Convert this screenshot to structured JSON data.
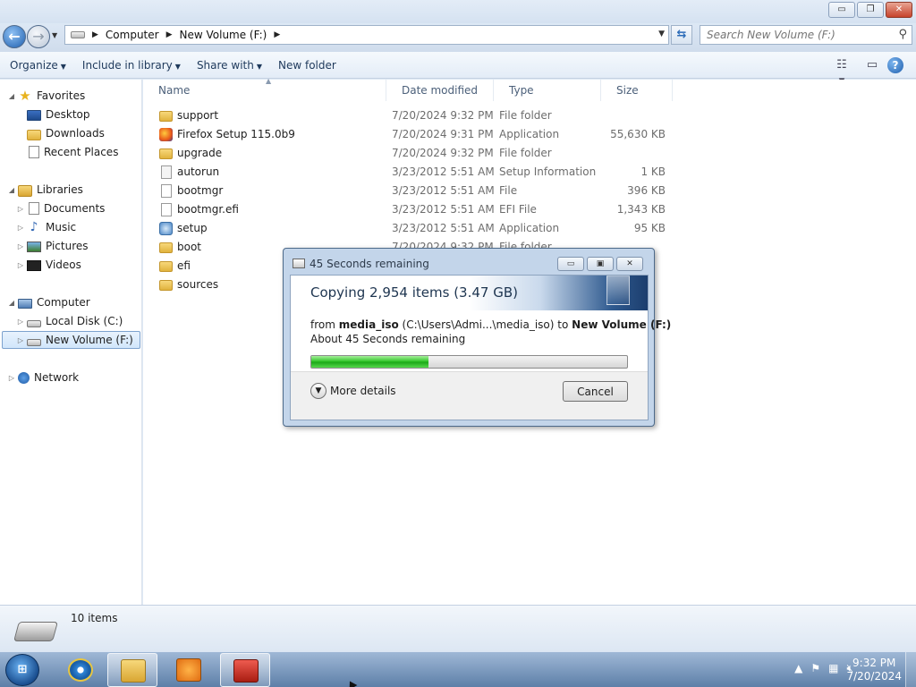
{
  "window": {
    "buttons": {
      "minimize": "▭",
      "maximize": "❐",
      "close": "✕"
    }
  },
  "address": {
    "back_icon": "back-arrow-icon",
    "crumbs": [
      "Computer",
      "New Volume (F:)"
    ],
    "search_placeholder": "Search New Volume (F:)"
  },
  "toolbar": {
    "organize": "Organize",
    "include_in_library": "Include in library",
    "share_with": "Share with",
    "new_folder": "New folder"
  },
  "nav": {
    "favorites": "Favorites",
    "desktop": "Desktop",
    "downloads": "Downloads",
    "recent_places": "Recent Places",
    "libraries": "Libraries",
    "documents": "Documents",
    "music": "Music",
    "pictures": "Pictures",
    "videos": "Videos",
    "computer": "Computer",
    "local_disk": "Local Disk (C:)",
    "new_volume": "New Volume (F:)",
    "network": "Network"
  },
  "columns": {
    "name": "Name",
    "date": "Date modified",
    "type": "Type",
    "size": "Size"
  },
  "files": [
    {
      "name": "support",
      "date": "7/20/2024 9:32 PM",
      "type": "File folder",
      "size": "",
      "icon": "folder-icon"
    },
    {
      "name": "Firefox Setup 115.0b9",
      "date": "7/20/2024 9:31 PM",
      "type": "Application",
      "size": "55,630 KB",
      "icon": "firefox-icon"
    },
    {
      "name": "upgrade",
      "date": "7/20/2024 9:32 PM",
      "type": "File folder",
      "size": "",
      "icon": "folder-icon"
    },
    {
      "name": "autorun",
      "date": "3/23/2012 5:51 AM",
      "type": "Setup Information",
      "size": "1 KB",
      "icon": "setup-info-icon"
    },
    {
      "name": "bootmgr",
      "date": "3/23/2012 5:51 AM",
      "type": "File",
      "size": "396 KB",
      "icon": "file-icon"
    },
    {
      "name": "bootmgr.efi",
      "date": "3/23/2012 5:51 AM",
      "type": "EFI File",
      "size": "1,343 KB",
      "icon": "file-icon"
    },
    {
      "name": "setup",
      "date": "3/23/2012 5:51 AM",
      "type": "Application",
      "size": "95 KB",
      "icon": "setup-app-icon"
    },
    {
      "name": "boot",
      "date": "7/20/2024 9:32 PM",
      "type": "File folder",
      "size": "",
      "icon": "folder-icon"
    },
    {
      "name": "efi",
      "date": "",
      "type": "",
      "size": "",
      "icon": "folder-icon"
    },
    {
      "name": "sources",
      "date": "",
      "type": "",
      "size": "",
      "icon": "folder-icon"
    }
  ],
  "status": {
    "item_count": "10 items"
  },
  "dialog": {
    "title": "45 Seconds remaining",
    "header": "Copying 2,954 items (3.47 GB)",
    "from_label": "from",
    "source_name": "media_iso",
    "source_path": "(C:\\Users\\Admi...\\media_iso)",
    "to_label": "to",
    "dest_name": "New Volume (F:)",
    "remaining": "About 45 Seconds remaining",
    "progress": 0.37,
    "more_details": "More details",
    "cancel": "Cancel"
  },
  "taskbar": {
    "start_label": "⊞",
    "clock_time": "9:32 PM",
    "clock_date": "7/20/2024"
  }
}
